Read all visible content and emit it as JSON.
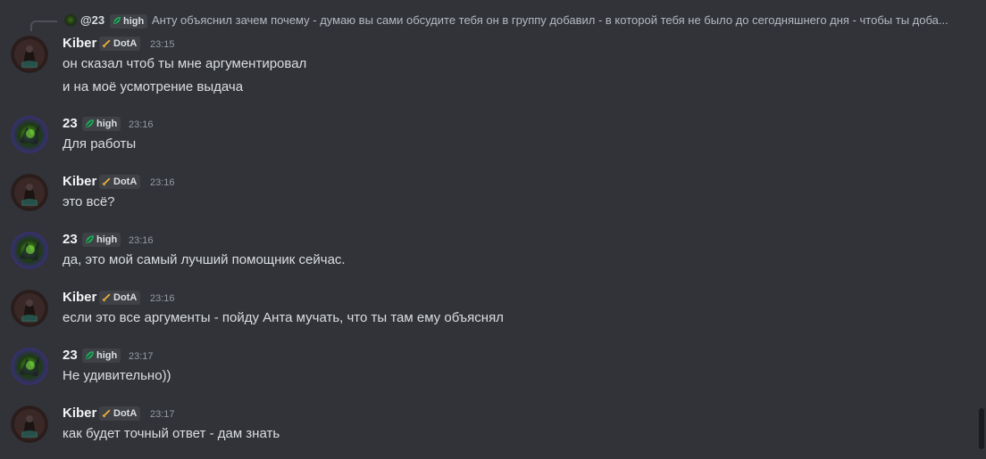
{
  "reply": {
    "name": "@23",
    "tag": "high",
    "text": "Анту объяснил зачем почему - думаю вы сами обсудите тебя он в группу добавил - в которой тебя не было до сегодняшнего дня - чтобы ты доба..."
  },
  "messages": [
    {
      "user": "Kiber",
      "tag": "DotA",
      "time": "23:15",
      "avatar": "kiber-avatar",
      "lines": [
        "он сказал чтоб ты мне аргументировал",
        "и на моё усмотрение выдача"
      ]
    },
    {
      "user": "23",
      "tag": "high",
      "time": "23:16",
      "avatar": "23-avatar",
      "lines": [
        "Для работы"
      ]
    },
    {
      "user": "Kiber",
      "tag": "DotA",
      "time": "23:16",
      "avatar": "kiber-avatar",
      "lines": [
        "это всё?"
      ]
    },
    {
      "user": "23",
      "tag": "high",
      "time": "23:16",
      "avatar": "23-avatar",
      "lines": [
        "да, это мой самый лучший помощник сейчас."
      ]
    },
    {
      "user": "Kiber",
      "tag": "DotA",
      "time": "23:16",
      "avatar": "kiber-avatar",
      "lines": [
        "если это все аргументы - пойду Анта мучать, что ты там ему объяснял"
      ]
    },
    {
      "user": "23",
      "tag": "high",
      "time": "23:17",
      "avatar": "23-avatar",
      "lines": [
        "Не удивительно))"
      ]
    },
    {
      "user": "Kiber",
      "tag": "DotA",
      "time": "23:17",
      "avatar": "kiber-avatar",
      "lines": [
        "как будет точный ответ - дам знать"
      ]
    }
  ],
  "colors": {
    "background": "#313338",
    "username": "#f2f3f5",
    "text": "#dbdee1",
    "timestamp": "#949ba4",
    "tag_bg": "#3f4147",
    "high_icon": "#23a55a",
    "dota_icon": "#f0b232"
  }
}
